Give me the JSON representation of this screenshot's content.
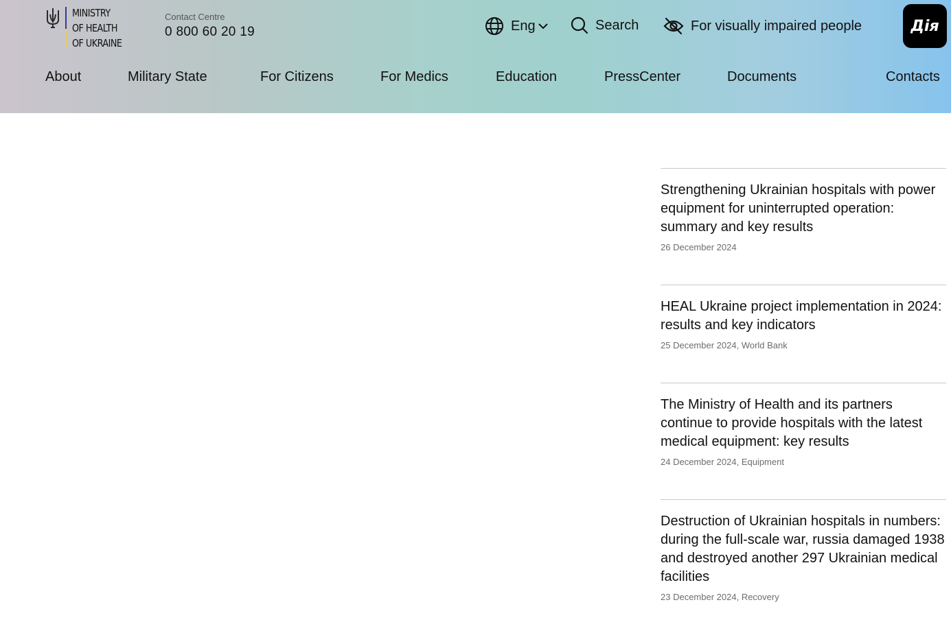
{
  "header": {
    "logo_text": "MINISTRY\nOF HEALTH\nOF UKRAINE",
    "contact_label": "Contact Centre",
    "contact_phone": "0 800 60 20 19",
    "language": "Eng",
    "search_label": "Search",
    "vision_label": "For visually impaired people",
    "diia_label": "Дія",
    "gradient_colors": [
      "#cbc4cd",
      "#a7d0cc",
      "#86c3ec"
    ]
  },
  "nav": {
    "items": [
      {
        "label": "About"
      },
      {
        "label": "Military State"
      },
      {
        "label": "For Citizens"
      },
      {
        "label": "For Medics"
      },
      {
        "label": "Education"
      },
      {
        "label": "PressCenter"
      },
      {
        "label": "Documents"
      },
      {
        "label": "Contacts"
      }
    ]
  },
  "news": [
    {
      "title": "Strengthening Ukrainian hospitals with power equipment for uninterrupted operation: summary and key results",
      "date": "26 December 2024",
      "tag": ""
    },
    {
      "title": "HEAL Ukraine project implementation in 2024: results and key indicators",
      "date": "25 December 2024",
      "tag": "World Bank"
    },
    {
      "title": "The Ministry of Health and its partners continue to provide hospitals with the latest medical equipment: key results",
      "date": "24 December 2024",
      "tag": "Equipment"
    },
    {
      "title": "Destruction of Ukrainian hospitals in numbers: during the full-scale war, russia damaged 1938 and destroyed another 297 Ukrainian medical facilities",
      "date": "23 December 2024",
      "tag": "Recovery"
    }
  ],
  "icons": {
    "logo": "tryzub-icon",
    "language": "globe-icon",
    "dropdown": "chevron-down-icon",
    "search": "search-icon",
    "vision": "eye-off-icon"
  }
}
